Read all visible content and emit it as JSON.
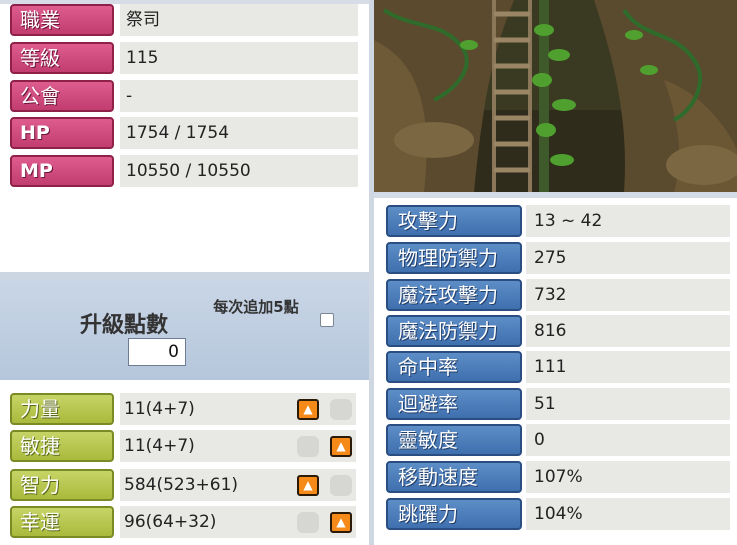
{
  "character_info": [
    {
      "label": "職業",
      "value": "祭司"
    },
    {
      "label": "等級",
      "value": "115"
    },
    {
      "label": "公會",
      "value": "-"
    },
    {
      "label": "HP",
      "value": "1754 / 1754"
    },
    {
      "label": "MP",
      "value": "10550 / 10550"
    }
  ],
  "level_points": {
    "label": "升級點數",
    "value": "0",
    "bulk_label": "每次追加5點",
    "bulk_checked": false
  },
  "base_stats": [
    {
      "label": "力量",
      "value": "11(4+7)"
    },
    {
      "label": "敏捷",
      "value": "11(4+7)"
    },
    {
      "label": "智力",
      "value": "584(523+61)"
    },
    {
      "label": "幸運",
      "value": "96(64+32)"
    }
  ],
  "combat_stats": [
    {
      "label": "攻擊力",
      "value": "13 ~ 42"
    },
    {
      "label": "物理防禦力",
      "value": "275"
    },
    {
      "label": "魔法攻擊力",
      "value": "732"
    },
    {
      "label": "魔法防禦力",
      "value": "816"
    },
    {
      "label": "命中率",
      "value": "111"
    },
    {
      "label": "迴避率",
      "value": "51"
    },
    {
      "label": "靈敏度",
      "value": "0"
    },
    {
      "label": "移動速度",
      "value": "107%"
    },
    {
      "label": "跳躍力",
      "value": "104%"
    }
  ],
  "icons": {
    "stat_increase": "up-arrow-icon"
  },
  "colors": {
    "info_label": "#c94377",
    "stat_label": "#b2c246",
    "combat_label": "#4a7bb9",
    "arrow_button": "#f58a18"
  }
}
